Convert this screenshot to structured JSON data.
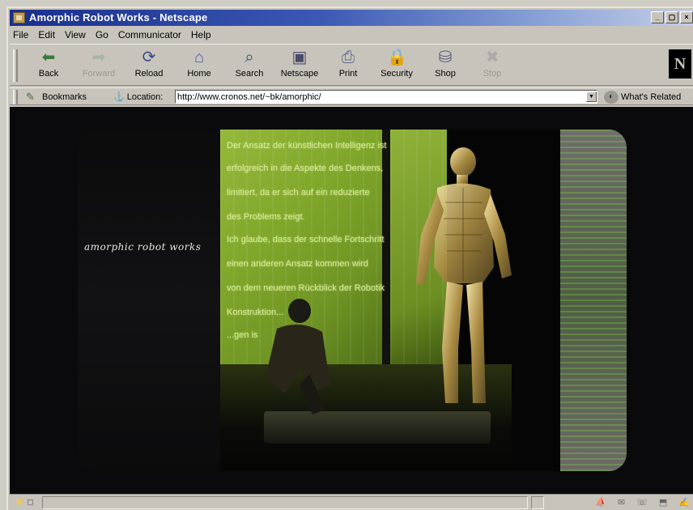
{
  "window": {
    "title": "Amorphic Robot Works - Netscape"
  },
  "menu": [
    "File",
    "Edit",
    "View",
    "Go",
    "Communicator",
    "Help"
  ],
  "toolbar": {
    "buttons": [
      {
        "label": "Back",
        "icon": "back-arrow-icon",
        "enabled": true
      },
      {
        "label": "Forward",
        "icon": "forward-arrow-icon",
        "enabled": false
      },
      {
        "label": "Reload",
        "icon": "reload-icon",
        "enabled": true
      },
      {
        "label": "Home",
        "icon": "home-icon",
        "enabled": true
      },
      {
        "label": "Search",
        "icon": "search-icon",
        "enabled": true
      },
      {
        "label": "Netscape",
        "icon": "netscape-icon",
        "enabled": true
      },
      {
        "label": "Print",
        "icon": "printer-icon",
        "enabled": true
      },
      {
        "label": "Security",
        "icon": "lock-icon",
        "enabled": true
      },
      {
        "label": "Shop",
        "icon": "shop-icon",
        "enabled": true
      },
      {
        "label": "Stop",
        "icon": "stop-icon",
        "enabled": false
      }
    ],
    "logo": "N"
  },
  "location": {
    "bookmarks_label": "Bookmarks",
    "location_label": "Location:",
    "url": "http://www.cronos.net/~bk/amorphic/",
    "related_label": "What's Related"
  },
  "page": {
    "site_title": "amorphic robot works",
    "green_text": [
      "Der Ansatz der künstlichen Intelligenz ist",
      "erfolgreich in die Aspekte des Denkens,",
      "limitiert, da er sich auf ein reduzierte",
      "des Problems zeigt.",
      "Ich glaube, dass der schnelle Fortschritt",
      "einen anderen Ansatz kommen wird",
      "von dem neueren Rückblick der Robotik",
      "Konstruktion...",
      "...gen is"
    ]
  },
  "colors": {
    "title_gradient_start": "#1a2f8c",
    "title_gradient_end": "#c4cfe6",
    "chrome": "#c8c4bc",
    "green_panel": "#7fa62a",
    "site_title_text": "#e6e6e6"
  }
}
